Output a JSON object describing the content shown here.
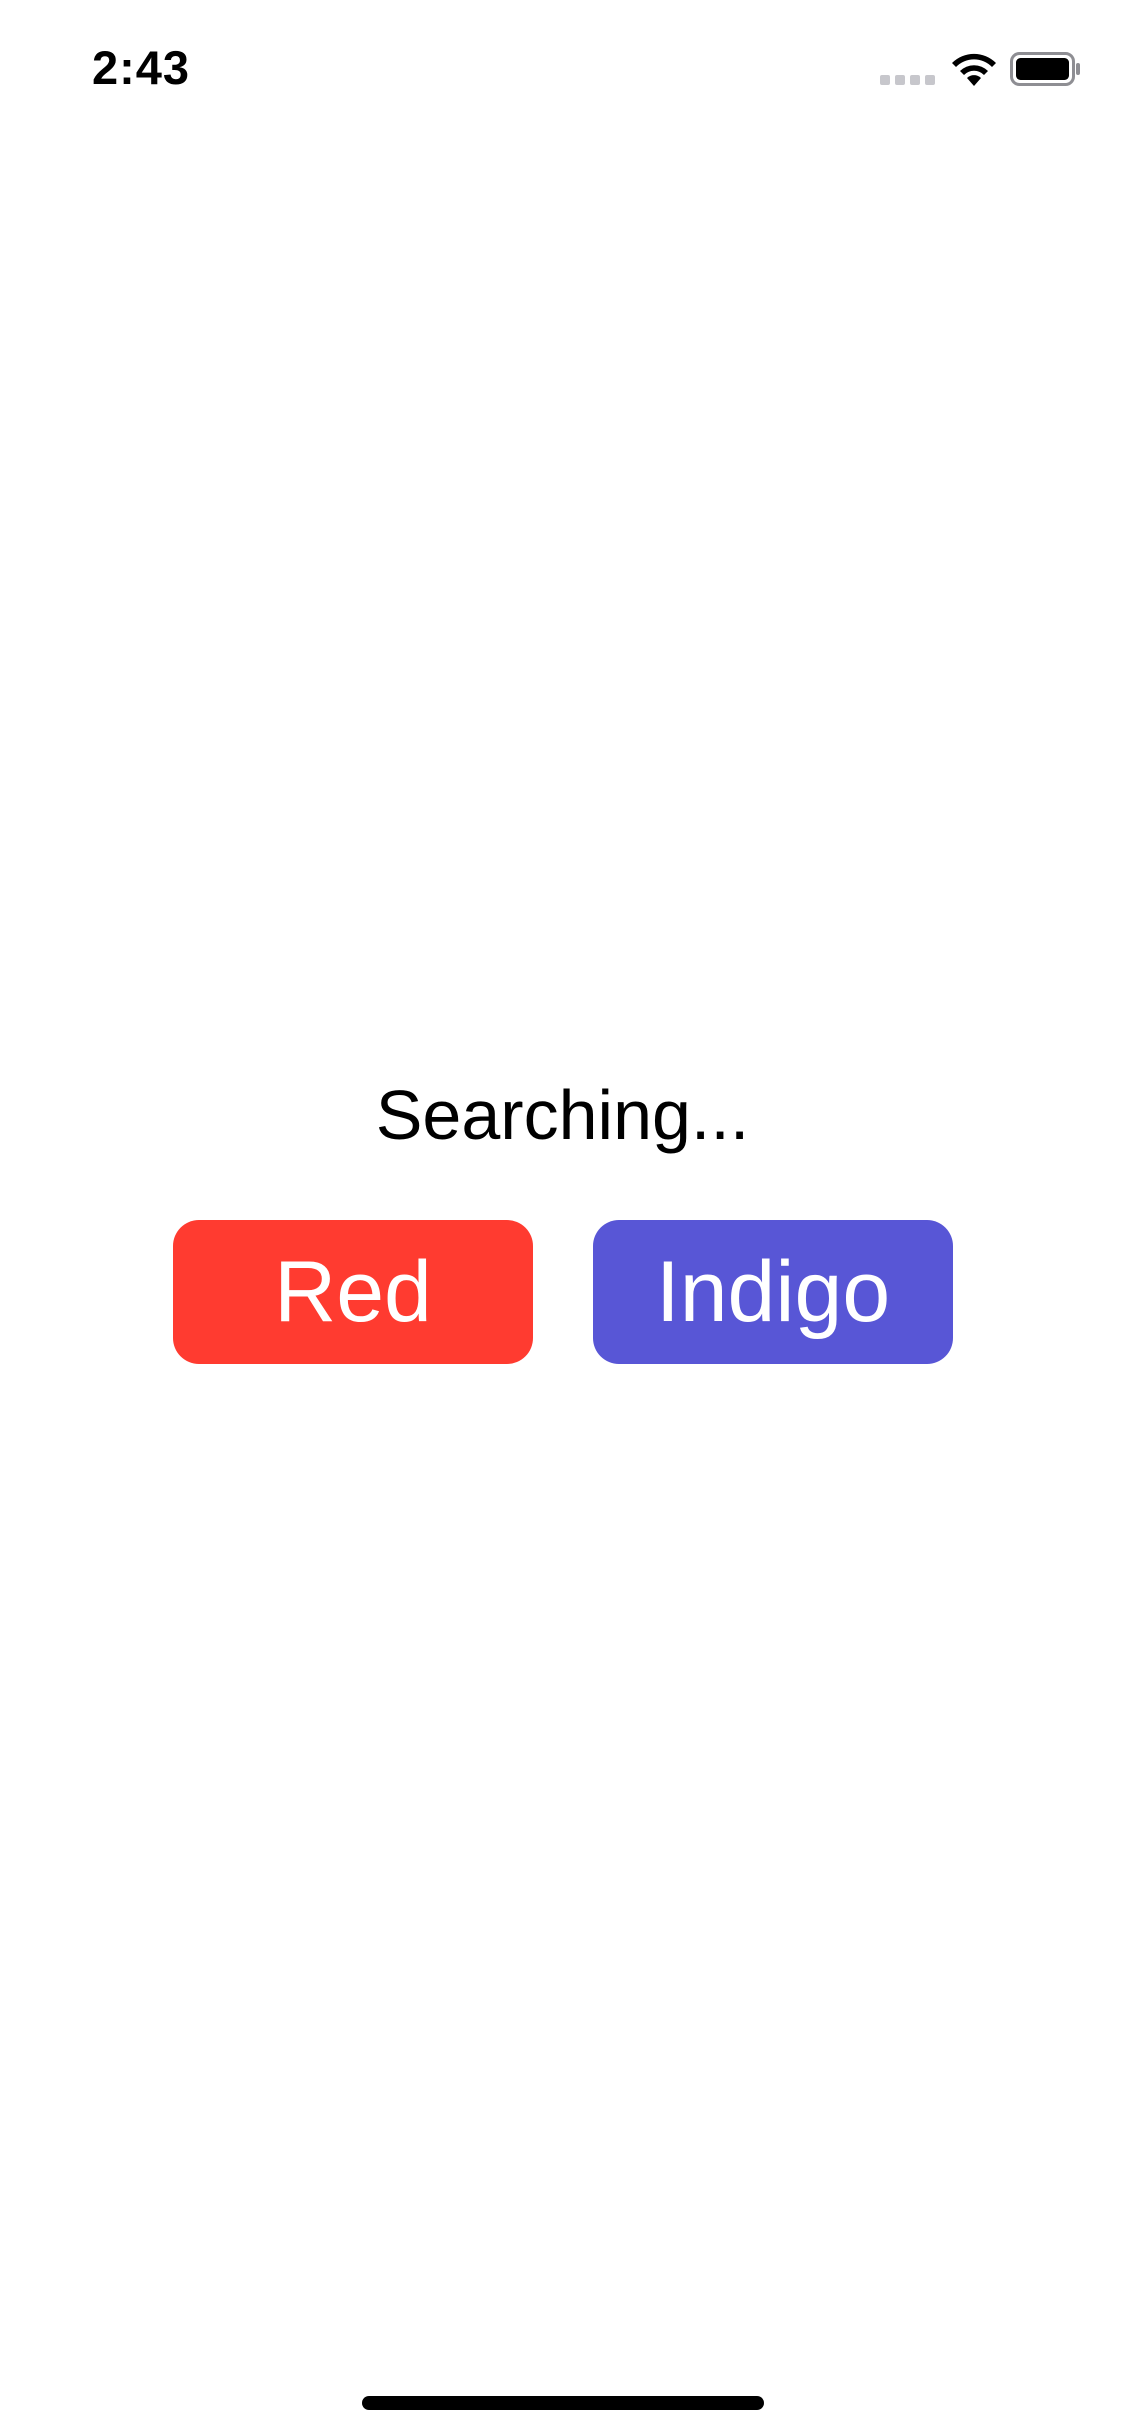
{
  "status_bar": {
    "time": "2:43",
    "icons": [
      "cellular-signal-icon",
      "wifi-icon",
      "battery-icon"
    ]
  },
  "main": {
    "status_text": "Searching...",
    "buttons": [
      {
        "label": "Red",
        "color": "#ff3b30"
      },
      {
        "label": "Indigo",
        "color": "#5856d6"
      }
    ]
  }
}
